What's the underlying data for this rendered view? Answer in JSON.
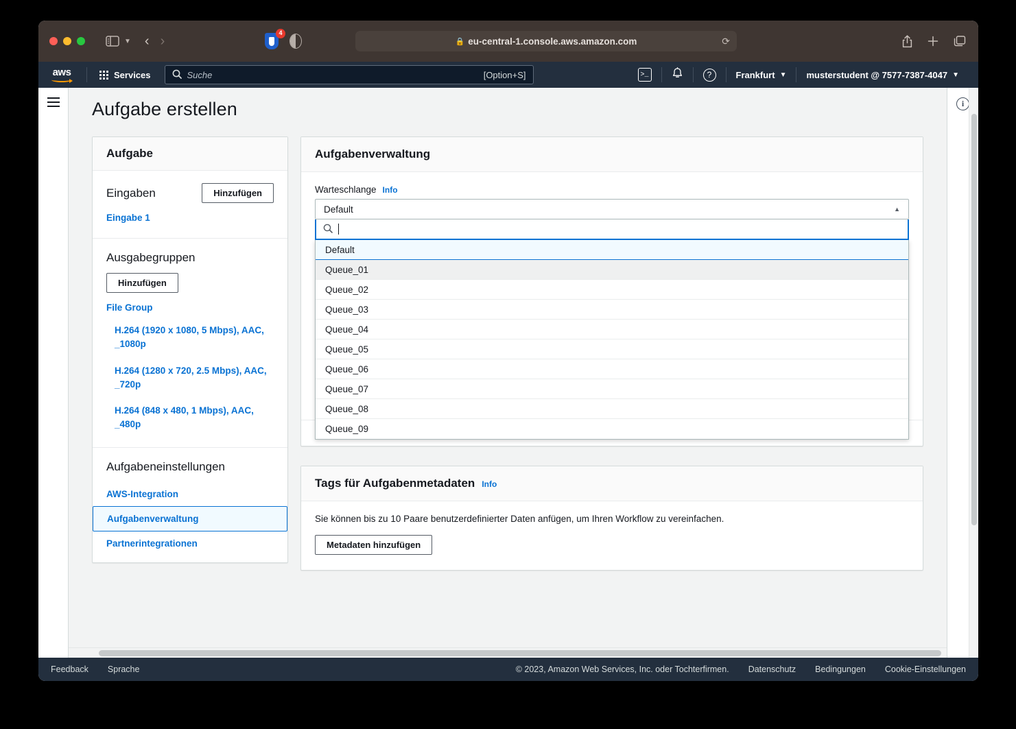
{
  "browser": {
    "url": "eu-central-1.console.aws.amazon.com",
    "lock_icon": "lock-icon",
    "reload_icon": "reload-icon",
    "back_icon": "chevron-left-icon",
    "forward_icon": "chevron-right-icon",
    "sidebar_icon": "sidebar-toggle-icon",
    "sidebar_chevron_icon": "chevron-down-icon",
    "extension_badge_count": "4",
    "share_icon": "share-icon",
    "new_tab_icon": "plus-icon",
    "tabs_overview_icon": "tabs-overview-icon"
  },
  "topnav": {
    "logo": "aws-logo",
    "services_label": "Services",
    "search_placeholder": "Suche",
    "search_value": "",
    "search_hint": "[Option+S]",
    "cloudshell_icon": "cloudshell-icon",
    "notifications_icon": "bell-icon",
    "help_icon": "question-mark-icon",
    "region": "Frankfurt",
    "account": "musterstudent @ 7577-7387-4047",
    "caret": "▼"
  },
  "page": {
    "title": "Aufgabe erstellen",
    "hamburger_icon": "hamburger-menu-icon",
    "info_icon": "info-circle-icon"
  },
  "job_card": {
    "header": "Aufgabe",
    "inputs": {
      "title": "Eingaben",
      "add_button": "Hinzufügen",
      "items": [
        "Eingabe 1"
      ]
    },
    "output_groups": {
      "title": "Ausgabegruppen",
      "add_button": "Hinzufügen",
      "group_name": "File Group",
      "items": [
        "H.264 (1920 x 1080, 5 Mbps), AAC, _1080p",
        "H.264 (1280 x 720, 2.5 Mbps), AAC, _720p",
        "H.264 (848 x 480, 1 Mbps), AAC, _480p"
      ]
    },
    "settings": {
      "title": "Aufgabeneinstellungen",
      "links": [
        {
          "label": "AWS-Integration",
          "selected": false
        },
        {
          "label": "Aufgabenverwaltung",
          "selected": true
        },
        {
          "label": "Partnerintegrationen",
          "selected": false
        }
      ]
    }
  },
  "job_management": {
    "header": "Aufgabenverwaltung",
    "queue_field": {
      "label": "Warteschlange",
      "info_label": "Info",
      "selected_value": "Default",
      "caret_icon": "chevron-up-icon",
      "search_icon": "search-icon",
      "search_value": "",
      "expanded": true,
      "options": [
        {
          "label": "Default",
          "state": "selected"
        },
        {
          "label": "Queue_01",
          "state": "hover"
        },
        {
          "label": "Queue_02",
          "state": "normal"
        },
        {
          "label": "Queue_03",
          "state": "normal"
        },
        {
          "label": "Queue_04",
          "state": "normal"
        },
        {
          "label": "Queue_05",
          "state": "normal"
        },
        {
          "label": "Queue_06",
          "state": "normal"
        },
        {
          "label": "Queue_07",
          "state": "normal"
        },
        {
          "label": "Queue_08",
          "state": "normal"
        },
        {
          "label": "Queue_09",
          "state": "normal"
        }
      ]
    }
  },
  "tags_panel": {
    "header": "Tags für Aufgabenmetadaten",
    "info_label": "Info",
    "description": "Sie können bis zu 10 Paare benutzerdefinierter Daten anfügen, um Ihren Workflow zu vereinfachen.",
    "add_button": "Metadaten hinzufügen"
  },
  "footer": {
    "feedback": "Feedback",
    "language": "Sprache",
    "copyright": "© 2023, Amazon Web Services, Inc. oder Tochterfirmen.",
    "privacy": "Datenschutz",
    "terms": "Bedingungen",
    "cookies": "Cookie-Einstellungen"
  },
  "colors": {
    "aws_navy": "#232f3e",
    "aws_orange": "#ff9900",
    "link_blue": "#0972d3",
    "selected_bg": "#f1faff",
    "hover_bg": "#eff0f0",
    "page_bg": "#f2f3f3",
    "border": "#d5dbdb"
  }
}
